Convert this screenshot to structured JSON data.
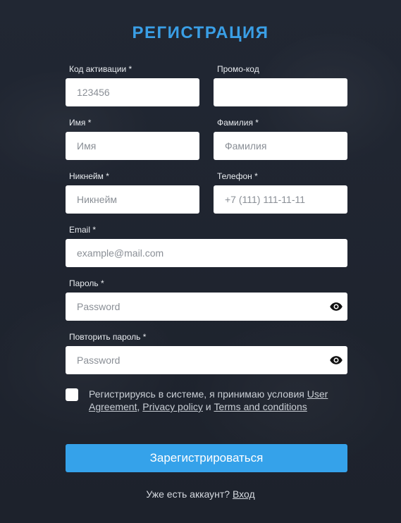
{
  "form": {
    "title": "РЕГИСТРАЦИЯ",
    "activation_code": {
      "label": "Код активации *",
      "placeholder": "123456",
      "value": ""
    },
    "promo_code": {
      "label": "Промо-код",
      "placeholder": "",
      "value": ""
    },
    "first_name": {
      "label": "Имя *",
      "placeholder": "Имя",
      "value": ""
    },
    "last_name": {
      "label": "Фамилия *",
      "placeholder": "Фамилия",
      "value": ""
    },
    "nickname": {
      "label": "Никнейм *",
      "placeholder": "Никнейм",
      "value": ""
    },
    "phone": {
      "label": "Телефон *",
      "placeholder": "+7 (111) 111-11-11",
      "value": ""
    },
    "email": {
      "label": "Email *",
      "placeholder": "example@mail.com",
      "value": ""
    },
    "password": {
      "label": "Пароль *",
      "placeholder": "Password",
      "value": "",
      "icon": "eye-icon"
    },
    "password_repeat": {
      "label": "Повторить пароль *",
      "placeholder": "Password",
      "value": "",
      "icon": "eye-icon"
    },
    "agreement": {
      "checked": false,
      "text_before": "Регистрируясь в системе, я принимаю условия ",
      "user_agreement": "User Agreement",
      "comma": ", ",
      "privacy_policy": "Privacy policy",
      "and": " и ",
      "terms": "Terms and conditions"
    },
    "submit_label": "Зарегистрироваться",
    "login_prompt": "Уже есть аккаунт? ",
    "login_link": "Вход"
  },
  "colors": {
    "background": "#1f2530",
    "accent": "#35a2ea",
    "title": "#3a9fe6"
  }
}
